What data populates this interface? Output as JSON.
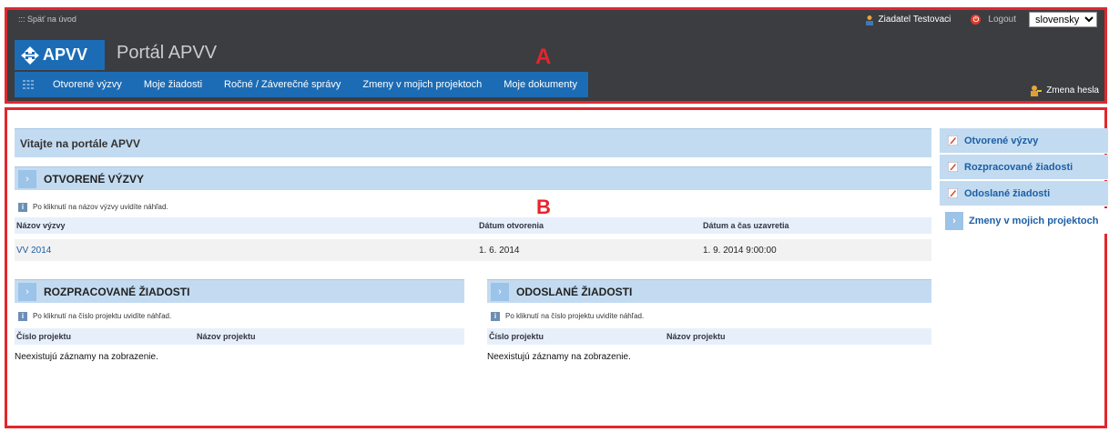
{
  "header": {
    "back_link": "::: Späť na úvod",
    "user_name": "Ziadatel Testovaci",
    "logout": "Logout",
    "language": "slovensky",
    "logo_text": "APVV",
    "portal_title": "Portál APVV",
    "annotation_label": "A",
    "password_change": "Zmena hesla"
  },
  "nav": {
    "items": [
      {
        "label": "Otvorené výzvy"
      },
      {
        "label": "Moje žiadosti"
      },
      {
        "label": "Ročné / Záverečné správy"
      },
      {
        "label": "Zmeny v mojich projektoch"
      },
      {
        "label": "Moje dokumenty"
      }
    ]
  },
  "main": {
    "annotation_label": "B",
    "welcome": "Vitajte na portále APVV",
    "open_calls": {
      "title": "OTVORENÉ VÝZVY",
      "hint": "Po kliknutí na názov výzvy uvidíte náhľad.",
      "columns": [
        "Názov výzvy",
        "Dátum otvorenia",
        "Dátum a čas uzavretia"
      ],
      "rows": [
        {
          "name": "VV 2014",
          "opened": "1. 6. 2014",
          "closes": "1. 9. 2014 9:00:00"
        }
      ]
    },
    "draft_applications": {
      "title": "ROZPRACOVANÉ ŽIADOSTI",
      "hint": "Po kliknutí na číslo projektu uvidíte náhľad.",
      "columns": [
        "Číslo projektu",
        "Názov projektu"
      ],
      "empty": "Neexistujú záznamy na zobrazenie."
    },
    "sent_applications": {
      "title": "ODOSLANÉ ŽIADOSTI",
      "hint": "Po kliknutí na číslo projektu uvidíte náhľad.",
      "columns": [
        "Číslo projektu",
        "Názov projektu"
      ],
      "empty": "Neexistujú záznamy na zobrazenie."
    }
  },
  "sidebar": {
    "items": [
      {
        "label": "Otvorené výzvy",
        "icon": "pencil-icon"
      },
      {
        "label": "Rozpracované žiadosti",
        "icon": "pencil-icon"
      },
      {
        "label": "Odoslané žiadosti",
        "icon": "pencil-icon"
      },
      {
        "label": "Zmeny v mojich projektoch",
        "icon": "chevron-right-icon"
      }
    ]
  },
  "colors": {
    "header_bg": "#3b3d40",
    "brand_blue": "#1c6cb5",
    "section_bg": "#c3dbf1",
    "annotation_red": "#e8232b"
  }
}
